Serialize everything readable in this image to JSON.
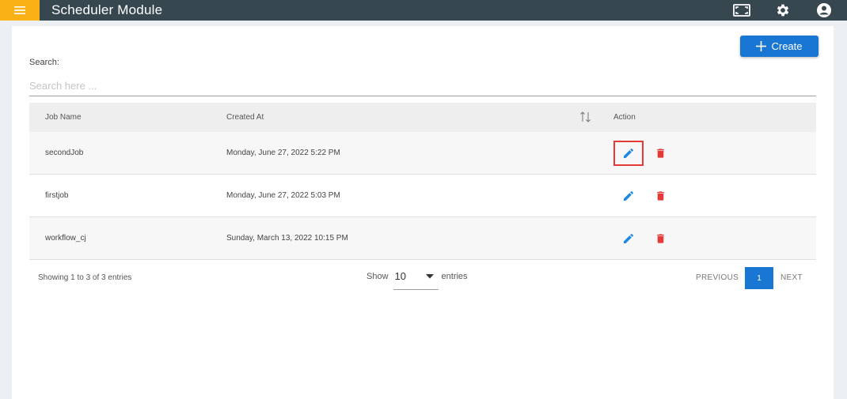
{
  "header": {
    "title": "Scheduler Module",
    "menu_icon": "hamburger-icon",
    "icons": [
      "fullscreen-icon",
      "gear-icon",
      "account-icon"
    ]
  },
  "toolbar": {
    "create_label": "Create"
  },
  "search": {
    "label": "Search:",
    "placeholder": "Search here ...",
    "value": ""
  },
  "table": {
    "columns": [
      "Job Name",
      "Created At",
      "Action"
    ],
    "rows": [
      {
        "job_name": "secondJob",
        "created_at": "Monday, June 27, 2022 5:22 PM"
      },
      {
        "job_name": "firstjob",
        "created_at": "Monday, June 27, 2022 5:03 PM"
      },
      {
        "job_name": "workflow_cj",
        "created_at": "Sunday, March 13, 2022 10:15 PM"
      }
    ]
  },
  "footer": {
    "info": "Showing 1 to 3 of 3 entries",
    "show_label": "Show",
    "page_size": "10",
    "entries_label": "entries",
    "previous": "PREVIOUS",
    "current_page": "1",
    "next": "NEXT"
  },
  "colors": {
    "topbar": "#37474f",
    "menu": "#f9b115",
    "accent": "#1976d2",
    "edit": "#1e88e5",
    "delete": "#e53935"
  }
}
